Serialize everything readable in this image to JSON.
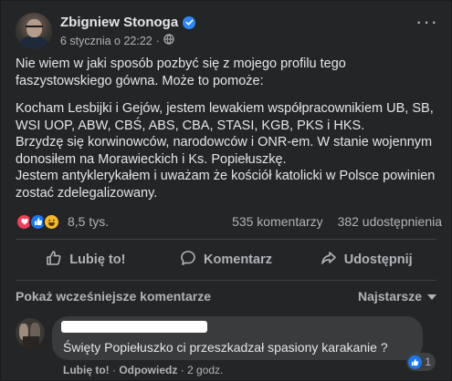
{
  "post": {
    "author": "Zbigniew Stonoga",
    "date": "6 stycznia o 22:22",
    "separator": "·",
    "paragraphs": [
      "Nie wiem w jaki sposób pozbyć się z mojego profilu tego faszystowskiego gówna. Może to pomoże:",
      "Kocham Lesbijki i Gejów, jestem lewakiem współpracownikiem UB, SB, WSI UOP, ABW, CBŚ, ABS, CBA, STASI, KGB, PKS i HKS.\nBrzydzę się korwinowców, narodowców  i ONR-em.  W stanie wojennym donosiłem na Morawieckich i Ks. Popiełuszkę.\nJestem antyklerykałem i uważam że kościół katolicki w Polsce powinien zostać zdelegalizowany."
    ]
  },
  "stats": {
    "reactions": "8,5 tys.",
    "comments": "535 komentarzy",
    "shares": "382 udostępnienia"
  },
  "actions": {
    "like": "Lubię to!",
    "comment": "Komentarz",
    "share": "Udostępnij"
  },
  "comments_bar": {
    "previous": "Pokaż wcześniejsze komentarze",
    "sort": "Najstarsze"
  },
  "comment": {
    "text": "Święty Popiełuszko ci przeszkadzał spasiony karakanie ?",
    "likes": "1",
    "like_action": "Lubię to!",
    "reply_action": "Odpowiedz",
    "time": "2 godz."
  },
  "colors": {
    "background": "#242526",
    "text": "#e4e6eb",
    "secondary": "#b0b3b8",
    "accent": "#1877f2",
    "verified": "#2d88ff"
  },
  "icons": {
    "verified": "verified-badge-icon",
    "audience": "globe-icon",
    "more": "more-options-icon",
    "like": "thumbs-up-icon",
    "comment": "comment-bubble-icon",
    "share": "share-arrow-icon",
    "sort": "chevron-down-icon"
  }
}
